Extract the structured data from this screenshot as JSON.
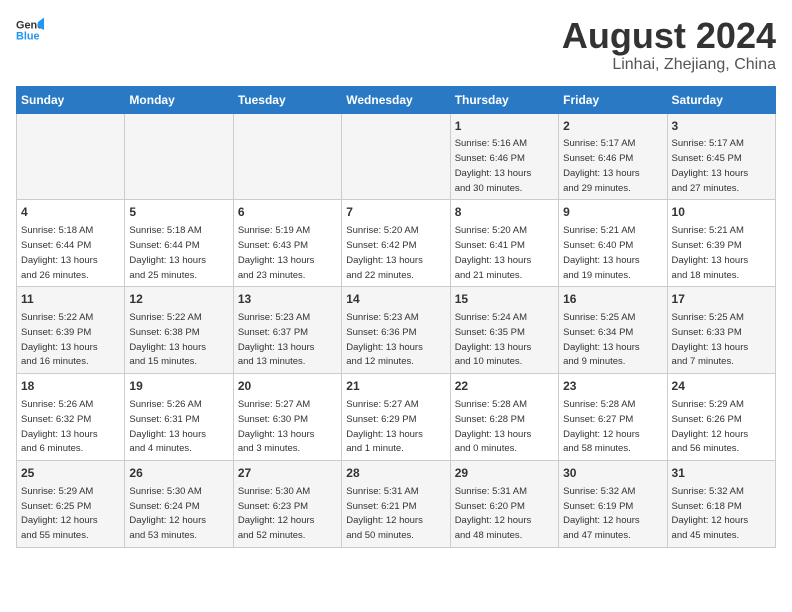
{
  "header": {
    "logo_line1": "General",
    "logo_line2": "Blue",
    "month_year": "August 2024",
    "location": "Linhai, Zhejiang, China"
  },
  "days_of_week": [
    "Sunday",
    "Monday",
    "Tuesday",
    "Wednesday",
    "Thursday",
    "Friday",
    "Saturday"
  ],
  "weeks": [
    [
      {
        "day": "",
        "info": ""
      },
      {
        "day": "",
        "info": ""
      },
      {
        "day": "",
        "info": ""
      },
      {
        "day": "",
        "info": ""
      },
      {
        "day": "1",
        "info": "Sunrise: 5:16 AM\nSunset: 6:46 PM\nDaylight: 13 hours\nand 30 minutes."
      },
      {
        "day": "2",
        "info": "Sunrise: 5:17 AM\nSunset: 6:46 PM\nDaylight: 13 hours\nand 29 minutes."
      },
      {
        "day": "3",
        "info": "Sunrise: 5:17 AM\nSunset: 6:45 PM\nDaylight: 13 hours\nand 27 minutes."
      }
    ],
    [
      {
        "day": "4",
        "info": "Sunrise: 5:18 AM\nSunset: 6:44 PM\nDaylight: 13 hours\nand 26 minutes."
      },
      {
        "day": "5",
        "info": "Sunrise: 5:18 AM\nSunset: 6:44 PM\nDaylight: 13 hours\nand 25 minutes."
      },
      {
        "day": "6",
        "info": "Sunrise: 5:19 AM\nSunset: 6:43 PM\nDaylight: 13 hours\nand 23 minutes."
      },
      {
        "day": "7",
        "info": "Sunrise: 5:20 AM\nSunset: 6:42 PM\nDaylight: 13 hours\nand 22 minutes."
      },
      {
        "day": "8",
        "info": "Sunrise: 5:20 AM\nSunset: 6:41 PM\nDaylight: 13 hours\nand 21 minutes."
      },
      {
        "day": "9",
        "info": "Sunrise: 5:21 AM\nSunset: 6:40 PM\nDaylight: 13 hours\nand 19 minutes."
      },
      {
        "day": "10",
        "info": "Sunrise: 5:21 AM\nSunset: 6:39 PM\nDaylight: 13 hours\nand 18 minutes."
      }
    ],
    [
      {
        "day": "11",
        "info": "Sunrise: 5:22 AM\nSunset: 6:39 PM\nDaylight: 13 hours\nand 16 minutes."
      },
      {
        "day": "12",
        "info": "Sunrise: 5:22 AM\nSunset: 6:38 PM\nDaylight: 13 hours\nand 15 minutes."
      },
      {
        "day": "13",
        "info": "Sunrise: 5:23 AM\nSunset: 6:37 PM\nDaylight: 13 hours\nand 13 minutes."
      },
      {
        "day": "14",
        "info": "Sunrise: 5:23 AM\nSunset: 6:36 PM\nDaylight: 13 hours\nand 12 minutes."
      },
      {
        "day": "15",
        "info": "Sunrise: 5:24 AM\nSunset: 6:35 PM\nDaylight: 13 hours\nand 10 minutes."
      },
      {
        "day": "16",
        "info": "Sunrise: 5:25 AM\nSunset: 6:34 PM\nDaylight: 13 hours\nand 9 minutes."
      },
      {
        "day": "17",
        "info": "Sunrise: 5:25 AM\nSunset: 6:33 PM\nDaylight: 13 hours\nand 7 minutes."
      }
    ],
    [
      {
        "day": "18",
        "info": "Sunrise: 5:26 AM\nSunset: 6:32 PM\nDaylight: 13 hours\nand 6 minutes."
      },
      {
        "day": "19",
        "info": "Sunrise: 5:26 AM\nSunset: 6:31 PM\nDaylight: 13 hours\nand 4 minutes."
      },
      {
        "day": "20",
        "info": "Sunrise: 5:27 AM\nSunset: 6:30 PM\nDaylight: 13 hours\nand 3 minutes."
      },
      {
        "day": "21",
        "info": "Sunrise: 5:27 AM\nSunset: 6:29 PM\nDaylight: 13 hours\nand 1 minute."
      },
      {
        "day": "22",
        "info": "Sunrise: 5:28 AM\nSunset: 6:28 PM\nDaylight: 13 hours\nand 0 minutes."
      },
      {
        "day": "23",
        "info": "Sunrise: 5:28 AM\nSunset: 6:27 PM\nDaylight: 12 hours\nand 58 minutes."
      },
      {
        "day": "24",
        "info": "Sunrise: 5:29 AM\nSunset: 6:26 PM\nDaylight: 12 hours\nand 56 minutes."
      }
    ],
    [
      {
        "day": "25",
        "info": "Sunrise: 5:29 AM\nSunset: 6:25 PM\nDaylight: 12 hours\nand 55 minutes."
      },
      {
        "day": "26",
        "info": "Sunrise: 5:30 AM\nSunset: 6:24 PM\nDaylight: 12 hours\nand 53 minutes."
      },
      {
        "day": "27",
        "info": "Sunrise: 5:30 AM\nSunset: 6:23 PM\nDaylight: 12 hours\nand 52 minutes."
      },
      {
        "day": "28",
        "info": "Sunrise: 5:31 AM\nSunset: 6:21 PM\nDaylight: 12 hours\nand 50 minutes."
      },
      {
        "day": "29",
        "info": "Sunrise: 5:31 AM\nSunset: 6:20 PM\nDaylight: 12 hours\nand 48 minutes."
      },
      {
        "day": "30",
        "info": "Sunrise: 5:32 AM\nSunset: 6:19 PM\nDaylight: 12 hours\nand 47 minutes."
      },
      {
        "day": "31",
        "info": "Sunrise: 5:32 AM\nSunset: 6:18 PM\nDaylight: 12 hours\nand 45 minutes."
      }
    ]
  ]
}
